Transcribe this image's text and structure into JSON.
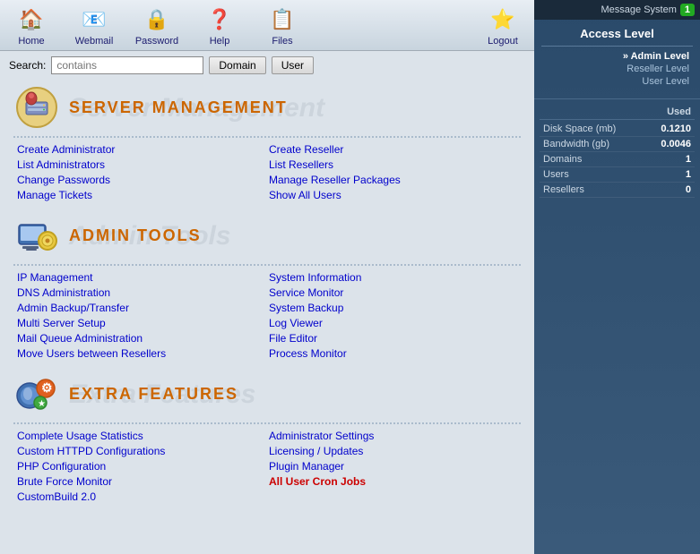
{
  "topnav": {
    "items": [
      {
        "label": "Home",
        "icon": "🏠",
        "name": "home"
      },
      {
        "label": "Webmail",
        "icon": "📧",
        "name": "webmail"
      },
      {
        "label": "Password",
        "icon": "🔒",
        "name": "password"
      },
      {
        "label": "Help",
        "icon": "❓",
        "name": "help"
      },
      {
        "label": "Files",
        "icon": "📋",
        "name": "files"
      },
      {
        "label": "Logout",
        "icon": "⭐",
        "name": "logout"
      }
    ]
  },
  "search": {
    "label": "Search:",
    "placeholder": "contains",
    "btn1": "Domain",
    "btn2": "User"
  },
  "sections": [
    {
      "id": "server-management",
      "title": "Server Management",
      "title_bg": "Server Management",
      "left_links": [
        {
          "text": "Create Administrator",
          "href": "#"
        },
        {
          "text": "List Administrators",
          "href": "#"
        },
        {
          "text": "Change Passwords",
          "href": "#"
        },
        {
          "text": "Manage Tickets",
          "href": "#"
        }
      ],
      "right_links": [
        {
          "text": "Create Reseller",
          "href": "#"
        },
        {
          "text": "List Resellers",
          "href": "#"
        },
        {
          "text": "Manage Reseller Packages",
          "href": "#"
        },
        {
          "text": "Show All Users",
          "href": "#"
        }
      ]
    },
    {
      "id": "admin-tools",
      "title": "Admin Tools",
      "title_bg": "Admin Tools",
      "left_links": [
        {
          "text": "IP Management",
          "href": "#"
        },
        {
          "text": "DNS Administration",
          "href": "#"
        },
        {
          "text": "Admin Backup/Transfer",
          "href": "#"
        },
        {
          "text": "Multi Server Setup",
          "href": "#"
        },
        {
          "text": "Mail Queue Administration",
          "href": "#"
        },
        {
          "text": "Move Users between Resellers",
          "href": "#"
        }
      ],
      "right_links": [
        {
          "text": "System Information",
          "href": "#"
        },
        {
          "text": "Service Monitor",
          "href": "#"
        },
        {
          "text": "System Backup",
          "href": "#"
        },
        {
          "text": "Log Viewer",
          "href": "#"
        },
        {
          "text": "File Editor",
          "href": "#"
        },
        {
          "text": "Process Monitor",
          "href": "#"
        }
      ]
    },
    {
      "id": "extra-features",
      "title": "Extra Features",
      "title_bg": "Extra Features",
      "left_links": [
        {
          "text": "Complete Usage Statistics",
          "href": "#"
        },
        {
          "text": "Custom HTTPD Configurations",
          "href": "#"
        },
        {
          "text": "PHP Configuration",
          "href": "#"
        },
        {
          "text": "Brute Force Monitor",
          "href": "#"
        },
        {
          "text": "CustomBuild 2.0",
          "href": "#"
        }
      ],
      "right_links": [
        {
          "text": "Administrator Settings",
          "href": "#"
        },
        {
          "text": "Licensing / Updates",
          "href": "#"
        },
        {
          "text": "Plugin Manager",
          "href": "#"
        },
        {
          "text": "All User Cron Jobs",
          "href": "#",
          "highlight": true
        }
      ]
    }
  ],
  "sidebar": {
    "msg_system": "Message System",
    "msg_count": "1",
    "access_level_title": "Access Level",
    "access_items": [
      {
        "label": "Admin Level",
        "active": true
      },
      {
        "label": "Reseller Level",
        "active": false
      },
      {
        "label": "User Level",
        "active": false
      }
    ],
    "stats_header": "Used",
    "stats": [
      {
        "label": "Disk Space (mb)",
        "value": "0.1210"
      },
      {
        "label": "Bandwidth (gb)",
        "value": "0.0046"
      },
      {
        "label": "Domains",
        "value": "1"
      },
      {
        "label": "Users",
        "value": "1"
      },
      {
        "label": "Resellers",
        "value": "0"
      }
    ]
  }
}
